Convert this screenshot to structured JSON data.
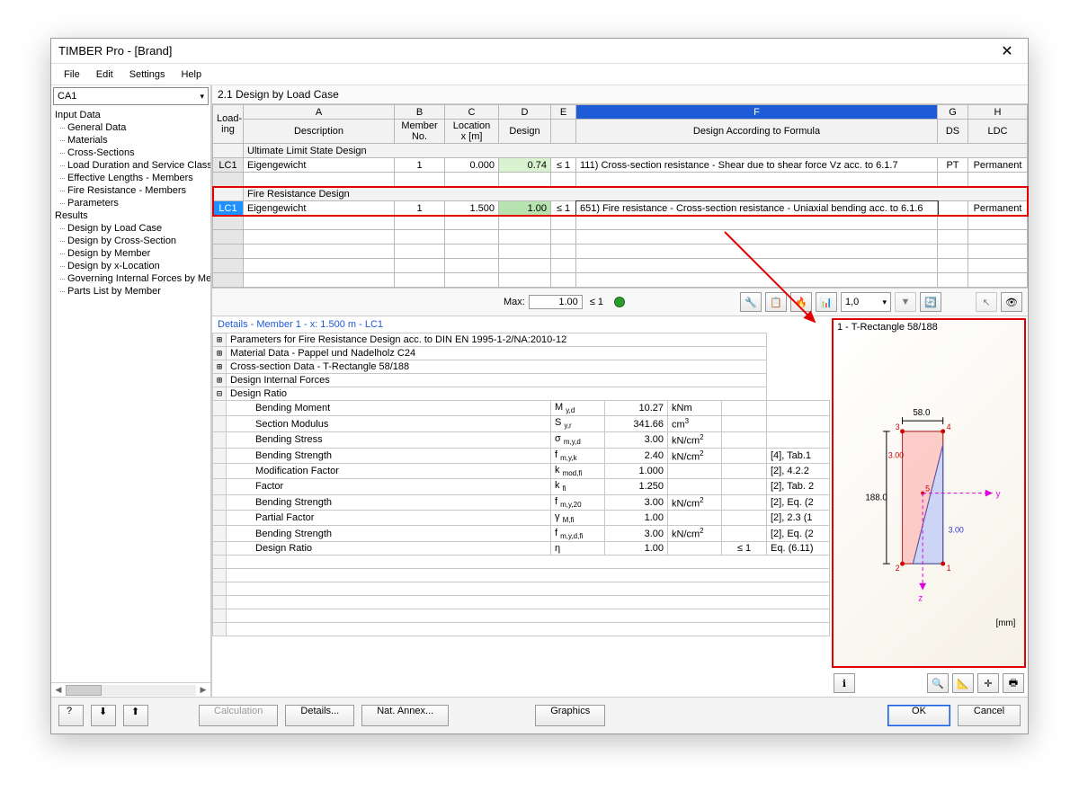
{
  "title": "TIMBER Pro - [Brand]",
  "menu": [
    "File",
    "Edit",
    "Settings",
    "Help"
  ],
  "ca_select": "CA1",
  "tree": {
    "group1": "Input Data",
    "g1items": [
      "General Data",
      "Materials",
      "Cross-Sections",
      "Load Duration and Service Class",
      "Effective Lengths - Members",
      "Fire Resistance - Members",
      "Parameters"
    ],
    "group2": "Results",
    "g2items": [
      "Design by Load Case",
      "Design by Cross-Section",
      "Design by Member",
      "Design by x-Location",
      "Governing Internal Forces by Member",
      "Parts List by Member"
    ]
  },
  "panel_title": "2.1  Design by Load Case",
  "cols": {
    "letters": [
      "A",
      "B",
      "C",
      "D",
      "E",
      "F",
      "G",
      "H"
    ],
    "load": "Load-",
    "ing": "ing",
    "desc": "Description",
    "member": "Member",
    "memberno": "No.",
    "loc": "Location",
    "locx": "x [m]",
    "design": "Design",
    "formula": "Design According to Formula",
    "ds": "DS",
    "ldc": "LDC"
  },
  "section_uls": "Ultimate Limit State Design",
  "row_uls": {
    "lc": "LC1",
    "desc": "Eigengewicht",
    "mem": "1",
    "x": "0.000",
    "ratio": "0.74",
    "le": "≤ 1",
    "formula": "111) Cross-section resistance - Shear due to shear force Vz acc. to 6.1.7",
    "ds": "PT",
    "ldc": "Permanent"
  },
  "section_fire": "Fire Resistance Design",
  "row_fire": {
    "lc": "LC1",
    "desc": "Eigengewicht",
    "mem": "1",
    "x": "1.500",
    "ratio": "1.00",
    "le": "≤ 1",
    "formula": "651) Fire resistance - Cross-section resistance - Uniaxial bending acc. to 6.1.6",
    "ds": "",
    "ldc": "Permanent"
  },
  "max": {
    "label": "Max:",
    "val": "1.00",
    "le": "≤ 1"
  },
  "scale": "1,0",
  "details_title": "Details - Member 1 - x: 1.500 m - LC1",
  "detail_groups": [
    "Parameters for Fire Resistance Design acc. to DIN EN 1995-1-2/NA:2010-12",
    "Material Data - Pappel und Nadelholz C24",
    "Cross-section Data - T-Rectangle 58/188",
    "Design Internal Forces",
    "Design Ratio"
  ],
  "drows": [
    {
      "n": "Bending Moment",
      "s": "M y,d",
      "v": "10.27",
      "u": "kNm",
      "c": "",
      "r": ""
    },
    {
      "n": "Section Modulus",
      "s": "S y,r",
      "v": "341.66",
      "u": "cm³",
      "c": "",
      "r": ""
    },
    {
      "n": "Bending Stress",
      "s": "σ m,y,d",
      "v": "3.00",
      "u": "kN/cm²",
      "c": "",
      "r": ""
    },
    {
      "n": "Bending Strength",
      "s": "f m,y,k",
      "v": "2.40",
      "u": "kN/cm²",
      "c": "",
      "r": "[4], Tab.1"
    },
    {
      "n": "Modification Factor",
      "s": "k mod,fi",
      "v": "1.000",
      "u": "",
      "c": "",
      "r": "[2], 4.2.2"
    },
    {
      "n": "Factor",
      "s": "k fi",
      "v": "1.250",
      "u": "",
      "c": "",
      "r": "[2], Tab. 2"
    },
    {
      "n": "Bending Strength",
      "s": "f m,y,20",
      "v": "3.00",
      "u": "kN/cm²",
      "c": "",
      "r": "[2], Eq. (2"
    },
    {
      "n": "Partial Factor",
      "s": "γ M,fi",
      "v": "1.00",
      "u": "",
      "c": "",
      "r": "[2], 2.3 (1"
    },
    {
      "n": "Bending Strength",
      "s": "f m,y,d,fi",
      "v": "3.00",
      "u": "kN/cm²",
      "c": "",
      "r": "[2], Eq. (2"
    },
    {
      "n": "Design Ratio",
      "s": "η",
      "v": "1.00",
      "u": "",
      "c": "≤ 1",
      "r": "Eq. (6.11)"
    }
  ],
  "preview": {
    "title": "1 - T-Rectangle 58/188",
    "w": "58.0",
    "h": "188.0",
    "off": "3.00",
    "unit": "[mm]"
  },
  "footer": {
    "calc": "Calculation",
    "details": "Details...",
    "nat": "Nat. Annex...",
    "graphics": "Graphics",
    "ok": "OK",
    "cancel": "Cancel"
  }
}
